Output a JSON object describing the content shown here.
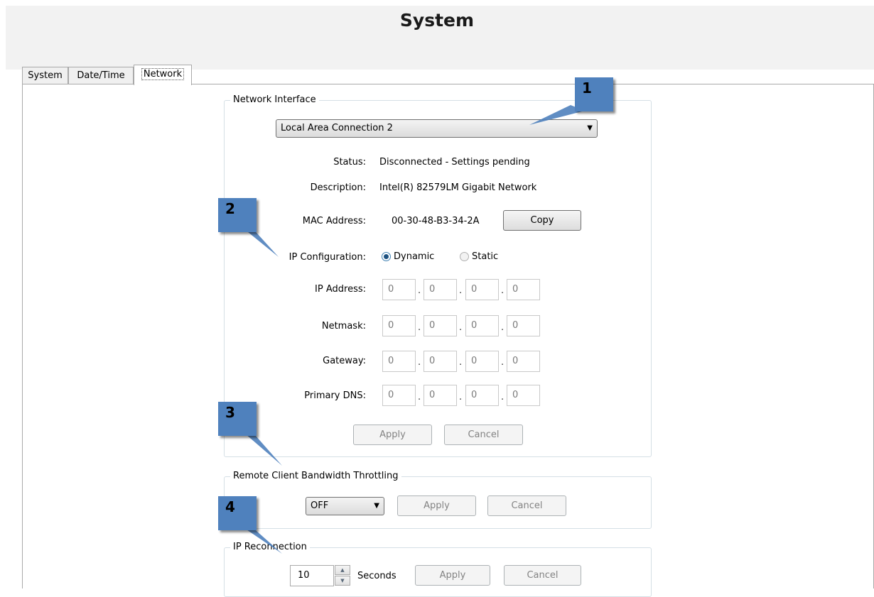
{
  "page": {
    "title": "System"
  },
  "tabs": [
    {
      "label": "System"
    },
    {
      "label": "Date/Time"
    },
    {
      "label": "Network"
    }
  ],
  "network_interface": {
    "group_title": "Network Interface",
    "selected_interface": "Local Area Connection 2",
    "status_label": "Status:",
    "status_value": "Disconnected - Settings pending",
    "description_label": "Description:",
    "description_value": "Intel(R) 82579LM Gigabit Network",
    "mac_label": "MAC Address:",
    "mac_value": "00-30-48-B3-34-2A",
    "copy_label": "Copy",
    "ip_config_label": "IP Configuration:",
    "ip_config_options": [
      "Dynamic",
      "Static"
    ],
    "ip_config_selected": "Dynamic",
    "fields": [
      {
        "label": "IP Address:",
        "octets": [
          "0",
          "0",
          "0",
          "0"
        ]
      },
      {
        "label": "Netmask:",
        "octets": [
          "0",
          "0",
          "0",
          "0"
        ]
      },
      {
        "label": "Gateway:",
        "octets": [
          "0",
          "0",
          "0",
          "0"
        ]
      },
      {
        "label": "Primary DNS:",
        "octets": [
          "0",
          "0",
          "0",
          "0"
        ]
      }
    ],
    "octet_separator": ".",
    "apply_label": "Apply",
    "cancel_label": "Cancel"
  },
  "bandwidth": {
    "group_title": "Remote Client Bandwidth Throttling",
    "selected": "OFF",
    "apply_label": "Apply",
    "cancel_label": "Cancel"
  },
  "reconnection": {
    "group_title": "IP Reconnection",
    "value": "10",
    "unit_label": "Seconds",
    "apply_label": "Apply",
    "cancel_label": "Cancel"
  },
  "callouts": [
    "1",
    "2",
    "3",
    "4"
  ],
  "colors": {
    "callout": "#4f81bd",
    "header_bg": "#f2f2f2",
    "radio_selected": "#1c5180"
  }
}
